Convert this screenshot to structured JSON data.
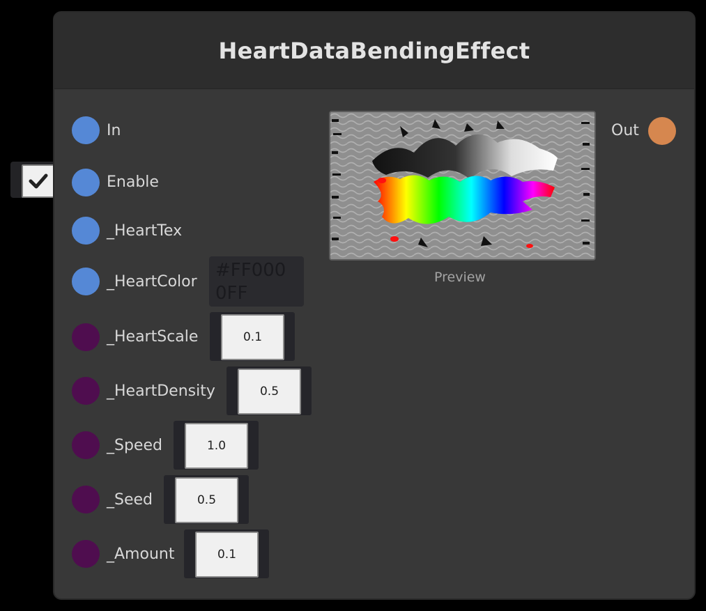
{
  "node": {
    "title": "HeartDataBendingEffect"
  },
  "ports": {
    "inputs": [
      {
        "label": "In",
        "type": "float4",
        "color": "#5588d6"
      },
      {
        "label": "Enable",
        "type": "bool",
        "color": "#5588d6",
        "checked": true
      },
      {
        "label": "_HeartTex",
        "type": "texture",
        "color": "#5588d6"
      },
      {
        "label": "_HeartColor",
        "type": "color",
        "color": "#5588d6",
        "value": "#FF000\n0FF"
      },
      {
        "label": "_HeartScale",
        "type": "float",
        "color": "#4f0d4f",
        "value": "0.1"
      },
      {
        "label": "_HeartDensity",
        "type": "float",
        "color": "#4f0d4f",
        "value": "0.5"
      },
      {
        "label": "_Speed",
        "type": "float",
        "color": "#4f0d4f",
        "value": "1.0"
      },
      {
        "label": "_Seed",
        "type": "float",
        "color": "#4f0d4f",
        "value": "0.5"
      },
      {
        "label": "_Amount",
        "type": "float",
        "color": "#4f0d4f",
        "value": "0.1"
      }
    ],
    "outputs": [
      {
        "label": "Out",
        "color": "#d6874f"
      }
    ]
  },
  "preview": {
    "label": "Preview"
  },
  "icons": {
    "checkbox": "checkmark-icon"
  }
}
